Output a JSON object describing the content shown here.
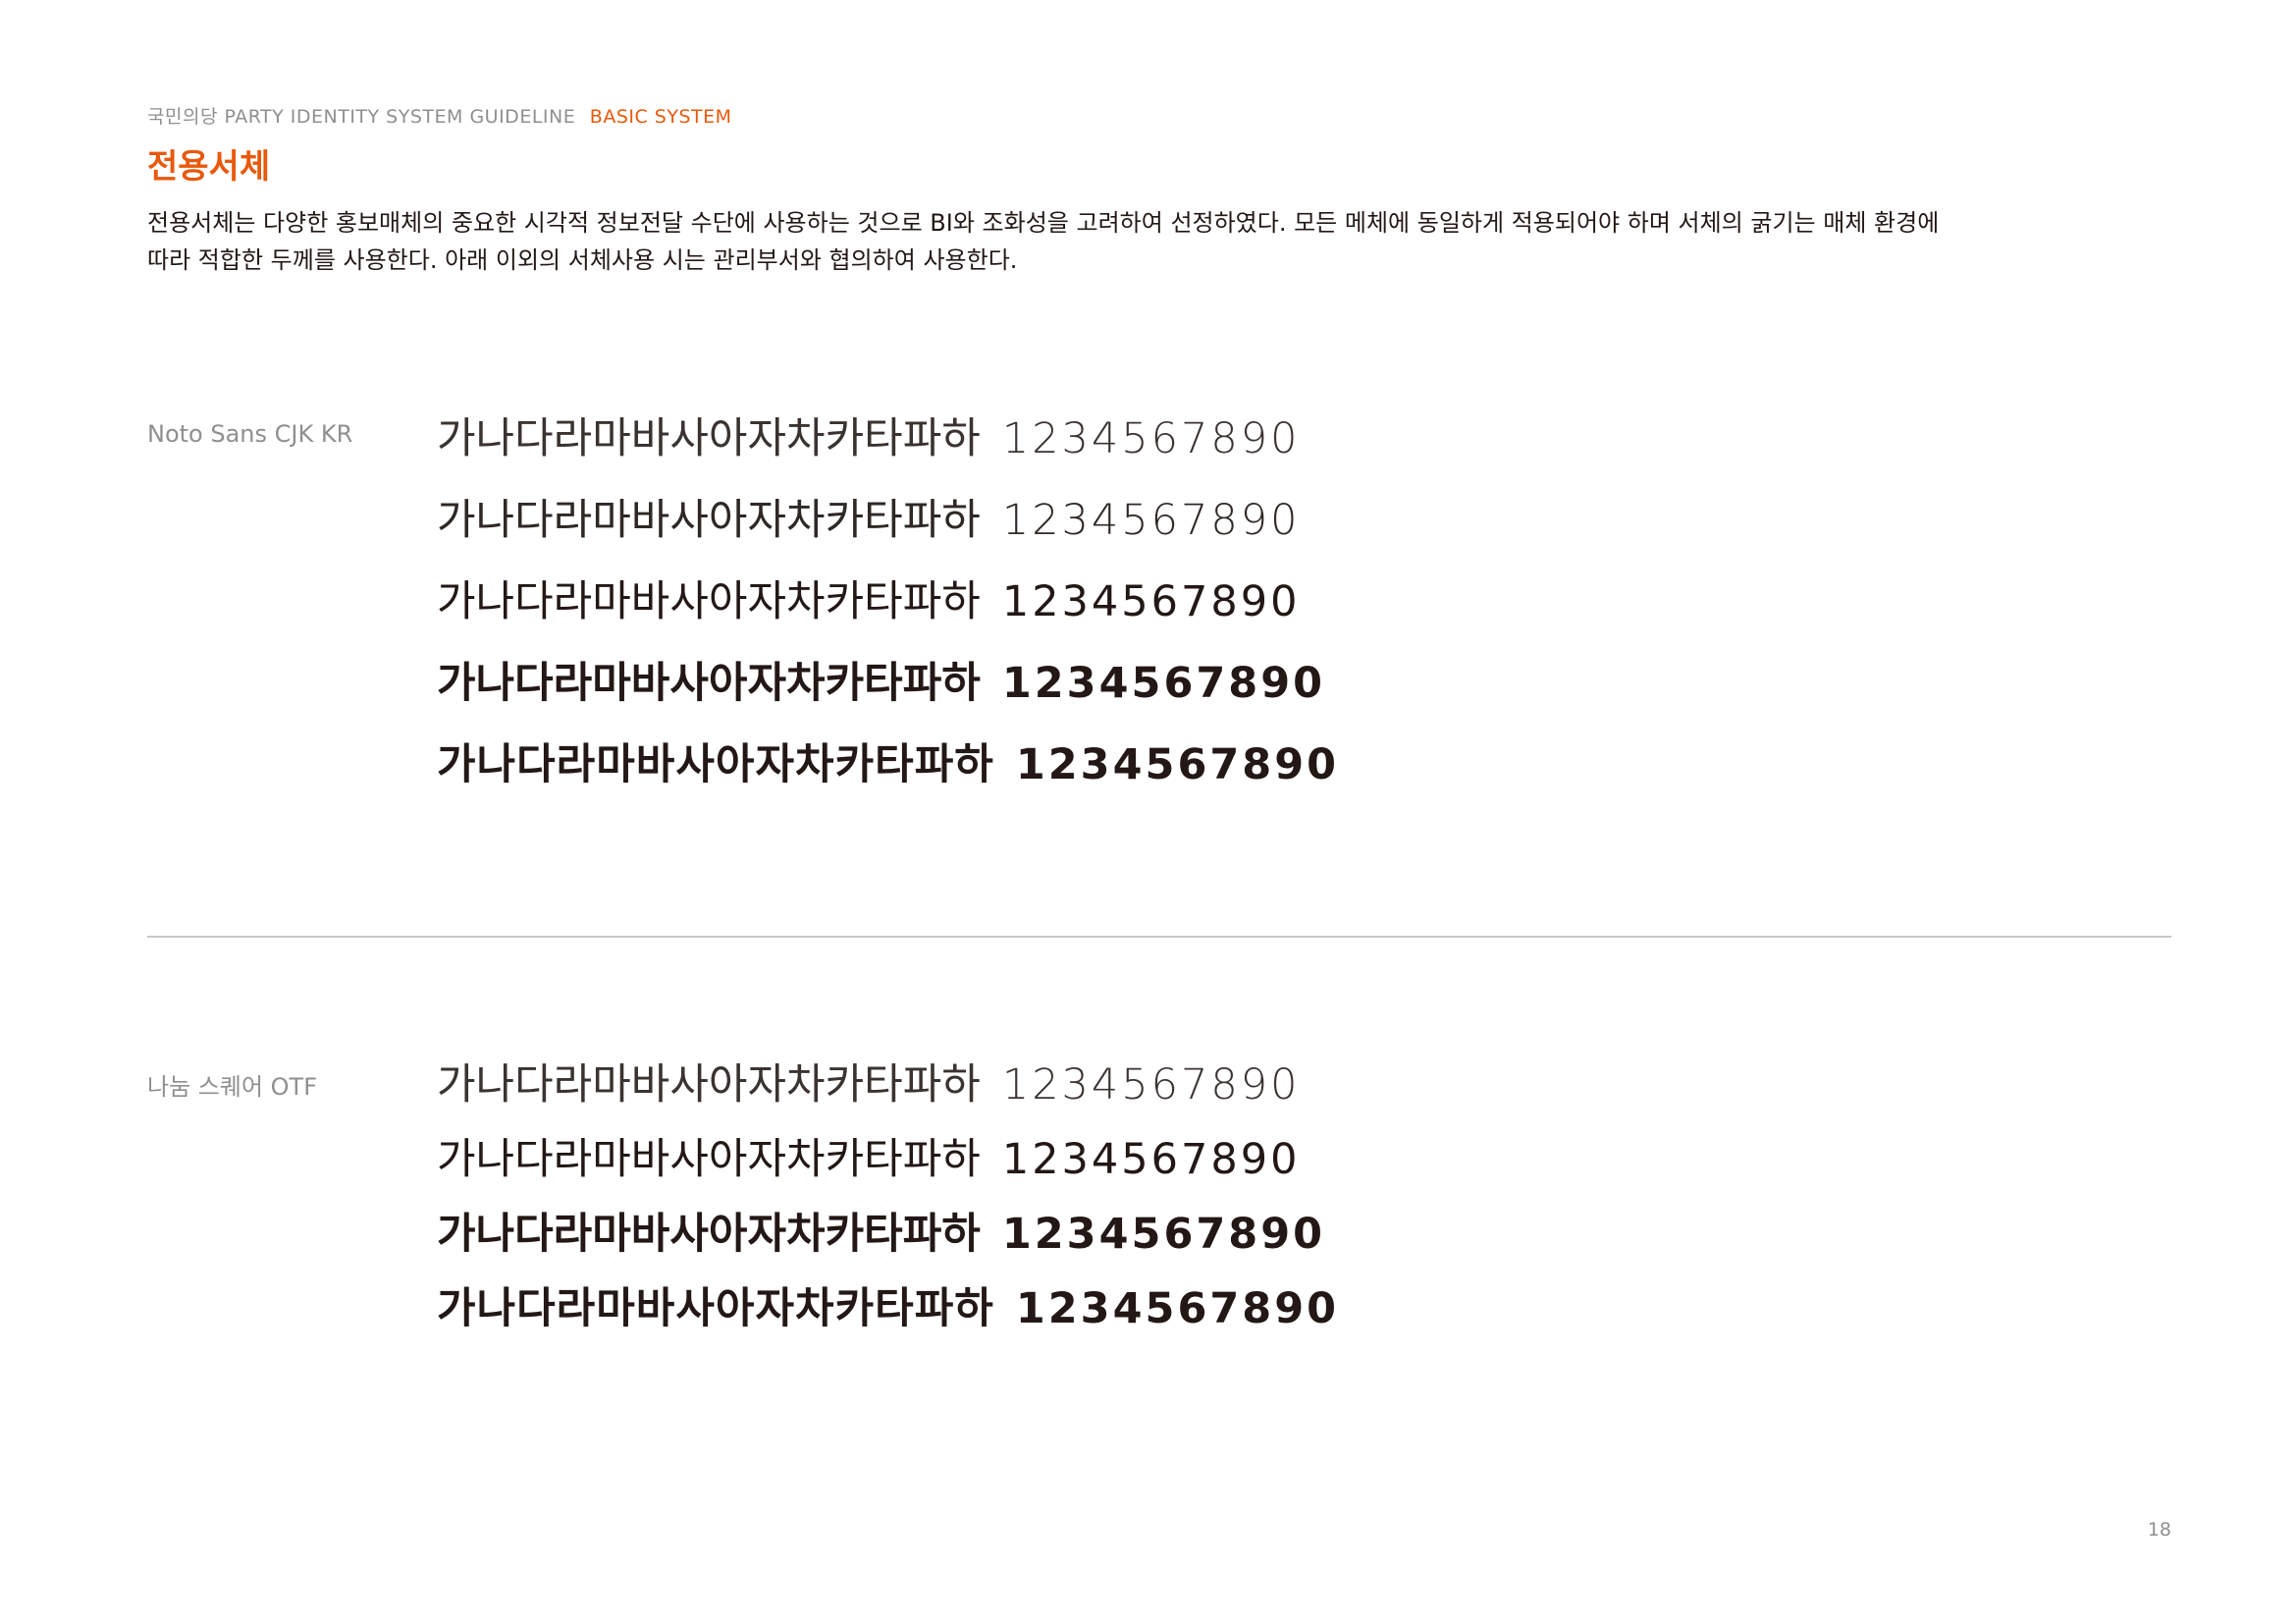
{
  "header": {
    "guide": "국민의당 PARTY IDENTITY SYSTEM GUIDELINE",
    "section": "BASIC SYSTEM"
  },
  "title": "전용서체",
  "description": {
    "line1": "전용서체는 다양한 홍보매체의 중요한 시각적 정보전달 수단에 사용하는 것으로 BI와 조화성을 고려하여 선정하였다. 모든 메체에 동일하게 적용되어야 하며 서체의 굵기는 매체 환경에",
    "line2": "따라 적합한 두께를 사용한다. 아래 이외의 서체사용 시는 관리부서와 협의하여 사용한다."
  },
  "fonts": [
    {
      "name": "Noto Sans CJK KR",
      "samples": [
        {
          "hangul": "가나다라마바사아자차카타파하",
          "digits": "1234567890"
        },
        {
          "hangul": "가나다라마바사아자차카타파하",
          "digits": "1234567890"
        },
        {
          "hangul": "가나다라마바사아자차카타파하",
          "digits": "1234567890"
        },
        {
          "hangul": "가나다라마바사아자차카타파하",
          "digits": "1234567890"
        },
        {
          "hangul": "가나다라마바사아자차카타파하",
          "digits": "1234567890"
        }
      ]
    },
    {
      "name": "나눔 스퀘어 OTF",
      "samples": [
        {
          "hangul": "가나다라마바사아자차카타파하",
          "digits": "1234567890"
        },
        {
          "hangul": "가나다라마바사아자차카타파하",
          "digits": "1234567890"
        },
        {
          "hangul": "가나다라마바사아자차카타파하",
          "digits": "1234567890"
        },
        {
          "hangul": "가나다라마바사아자차카타파하",
          "digits": "1234567890"
        }
      ]
    }
  ],
  "page_number": "18",
  "colors": {
    "accent": "#e8590c",
    "text": "#231815",
    "muted": "#8f8f8f",
    "divider": "#c9c9c9"
  }
}
